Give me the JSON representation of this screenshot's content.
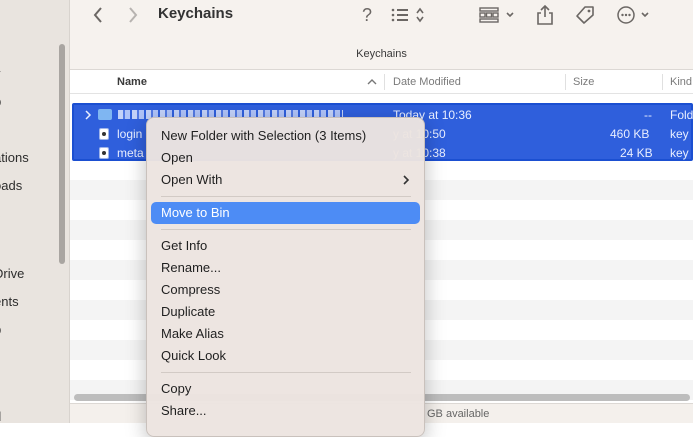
{
  "sidebar": {
    "items": [
      "y",
      "p",
      "s",
      "ations",
      "oads",
      "s",
      "Drive",
      "ents",
      "p",
      "d"
    ]
  },
  "toolbar": {
    "title": "Keychains",
    "path_title": "Keychains"
  },
  "columns": {
    "name": "Name",
    "date_modified": "Date Modified",
    "size": "Size",
    "kind": "Kind"
  },
  "rows": [
    {
      "name": "",
      "date": "Today at 10:36",
      "size": "--",
      "kind": "Fold"
    },
    {
      "name": "login",
      "date": "y at 10:50",
      "size": "460 KB",
      "kind": "key"
    },
    {
      "name": "meta",
      "date": "y at 10:38",
      "size": "24 KB",
      "kind": "key"
    }
  ],
  "status": {
    "available": "GB available"
  },
  "context_menu": {
    "group1": [
      "New Folder with Selection (3 Items)",
      "Open",
      "Open With"
    ],
    "move_to_bin": "Move to Bin",
    "group2": [
      "Get Info",
      "Rename...",
      "Compress",
      "Duplicate",
      "Make Alias",
      "Quick Look"
    ],
    "group3": [
      "Copy",
      "Share..."
    ]
  },
  "colors": {
    "selection": "#2f5fdc",
    "menu_highlight": "#4d8cf5",
    "sidebar_bg": "#e9e4df"
  }
}
